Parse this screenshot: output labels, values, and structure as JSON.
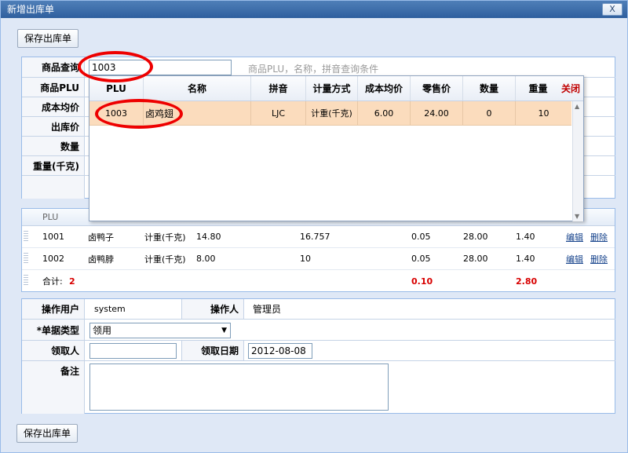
{
  "window": {
    "title": "新增出库单",
    "close": "X"
  },
  "toolbar": {
    "save_label": "保存出库单"
  },
  "form": {
    "search_label": "商品查询",
    "search_value": "1003",
    "search_hint": "商品PLU，名称，拼音查询条件",
    "plu_label": "商品PLU",
    "avg_cost_label": "成本均价",
    "out_price_label": "出库价",
    "qty_label": "数量",
    "weight_label": "重量(千克)"
  },
  "popup": {
    "headers": [
      "PLU",
      "名称",
      "拼音",
      "计量方式",
      "成本均价",
      "零售价",
      "数量",
      "重量"
    ],
    "close_label": "关闭",
    "row": [
      "1003",
      "卤鸡翅",
      "LJC",
      "计重(千克)",
      "6.00",
      "24.00",
      "0",
      "10"
    ]
  },
  "grid": {
    "header_first": "PLU",
    "rows": [
      {
        "plu": "1001",
        "name": "卤鸭子",
        "method": "计重(千克)",
        "price": "14.80",
        "total": "16.757",
        "qty": "0.05",
        "retail": "28.00",
        "weight": "1.40",
        "edit": "编辑",
        "del": "删除"
      },
      {
        "plu": "1002",
        "name": "卤鸭脖",
        "method": "计重(千克)",
        "price": "8.00",
        "total": "10",
        "qty": "0.05",
        "retail": "28.00",
        "weight": "1.40",
        "edit": "编辑",
        "del": "删除"
      }
    ],
    "summary": {
      "label": "合计:",
      "count": "2",
      "qty_total": "0.10",
      "weight_total": "2.80"
    }
  },
  "bottom": {
    "operator_user_label": "操作用户",
    "operator_user_value": "system",
    "operator_label": "操作人",
    "operator_value": "管理员",
    "doc_type_label": "*单据类型",
    "doc_type_value": "领用",
    "receiver_label": "领取人",
    "receiver_value": "",
    "receive_date_label": "领取日期",
    "receive_date_value": "2012-08-08",
    "note_label": "备注",
    "note_value": ""
  },
  "footer": {
    "save_label": "保存出库单"
  },
  "colors": {
    "title_bar": "#3a6aa8",
    "highlight_row": "#fbdcbd",
    "annotation": "#e00000",
    "total_red": "#d80000"
  }
}
